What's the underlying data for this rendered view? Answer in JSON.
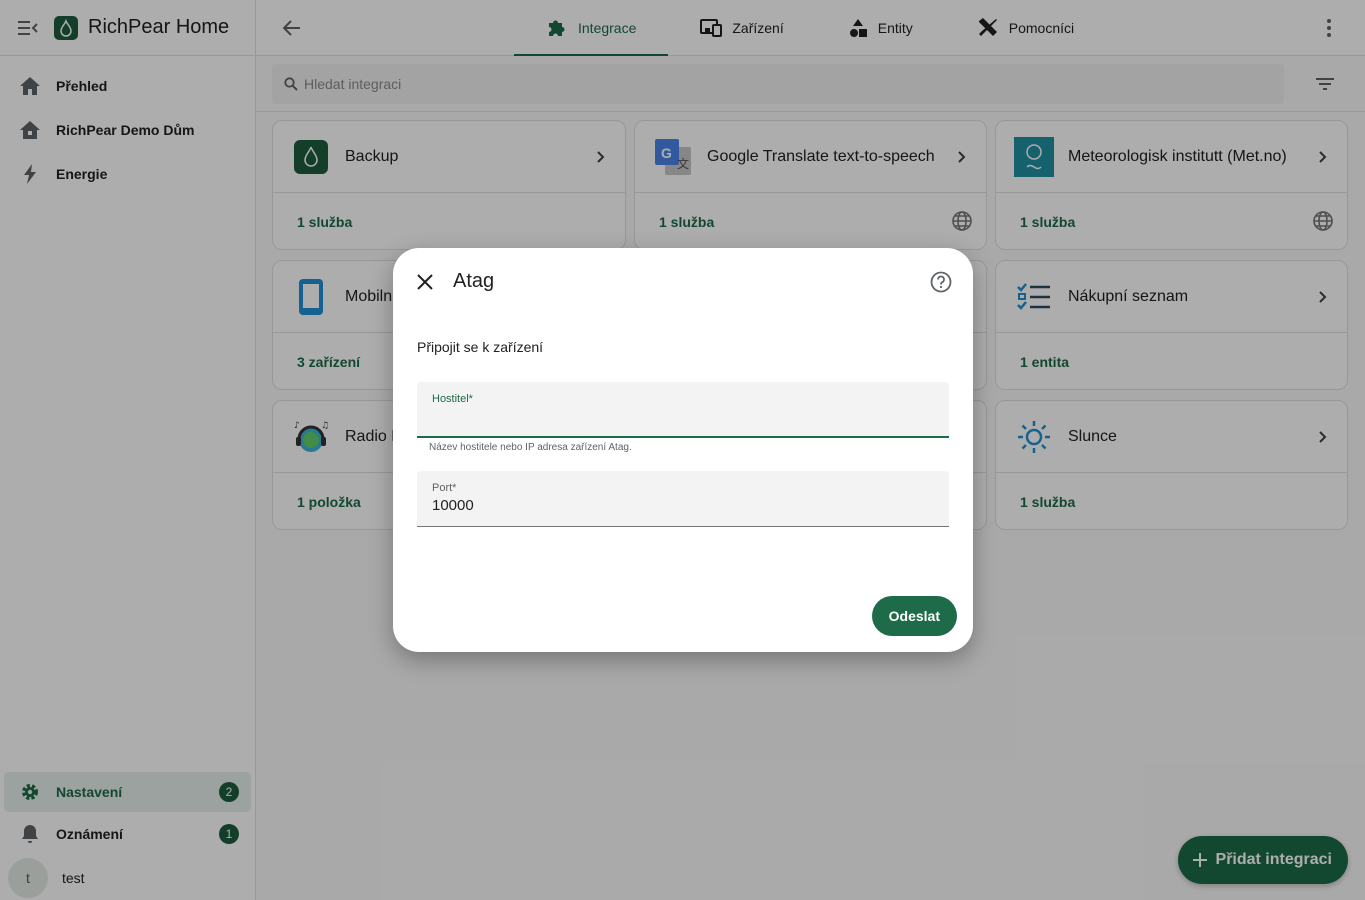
{
  "app": {
    "title": "RichPear Home"
  },
  "sidebar": {
    "items": [
      {
        "label": "Přehled",
        "icon": "home-icon"
      },
      {
        "label": "RichPear Demo Dům",
        "icon": "home-outline-icon"
      },
      {
        "label": "Energie",
        "icon": "lightning-icon"
      }
    ],
    "bottom": {
      "settings_label": "Nastavení",
      "settings_badge": "2",
      "notifications_label": "Oznámení",
      "notifications_badge": "1",
      "user_initial": "t",
      "user_name": "test"
    }
  },
  "header": {
    "tabs": [
      {
        "label": "Integrace",
        "icon": "puzzle-icon",
        "active": true
      },
      {
        "label": "Zařízení",
        "icon": "devices-icon",
        "active": false
      },
      {
        "label": "Entity",
        "icon": "shapes-icon",
        "active": false
      },
      {
        "label": "Pomocníci",
        "icon": "tools-icon",
        "active": false
      }
    ]
  },
  "search": {
    "placeholder": "Hledat integraci"
  },
  "cards": [
    {
      "title": "Backup",
      "footer": "1 služba",
      "globe": false,
      "icon": "backup-logo-icon"
    },
    {
      "title": "Google Translate text-to-speech",
      "footer": "1 služba",
      "globe": true,
      "icon": "google-translate-icon"
    },
    {
      "title": "Meteorologisk institutt (Met.no)",
      "footer": "1 služba",
      "globe": true,
      "icon": "met-no-icon"
    },
    {
      "title": "Mobilní aplikace",
      "footer": "3 zařízení",
      "globe": false,
      "icon": "phone-icon"
    },
    {
      "title": "",
      "footer": "",
      "globe": false,
      "icon": ""
    },
    {
      "title": "Nákupní seznam",
      "footer": "1 entita",
      "globe": false,
      "icon": "checklist-icon"
    },
    {
      "title": "Radio Browser",
      "footer": "1 položka",
      "globe": false,
      "icon": "radio-icon"
    },
    {
      "title": "",
      "footer": "",
      "globe": false,
      "icon": ""
    },
    {
      "title": "Slunce",
      "footer": "1 služba",
      "globe": false,
      "icon": "sun-icon"
    }
  ],
  "fab": {
    "label": "Přidat integraci"
  },
  "dialog": {
    "title": "Atag",
    "description": "Připojit se k zařízení",
    "host_label": "Hostitel*",
    "host_value": "",
    "host_helper": "Název hostitele nebo IP adresa zařízení Atag.",
    "port_label": "Port*",
    "port_value": "10000",
    "submit_label": "Odeslat"
  },
  "colors": {
    "accent": "#1d6b48",
    "brand": "#1d5e3f"
  }
}
